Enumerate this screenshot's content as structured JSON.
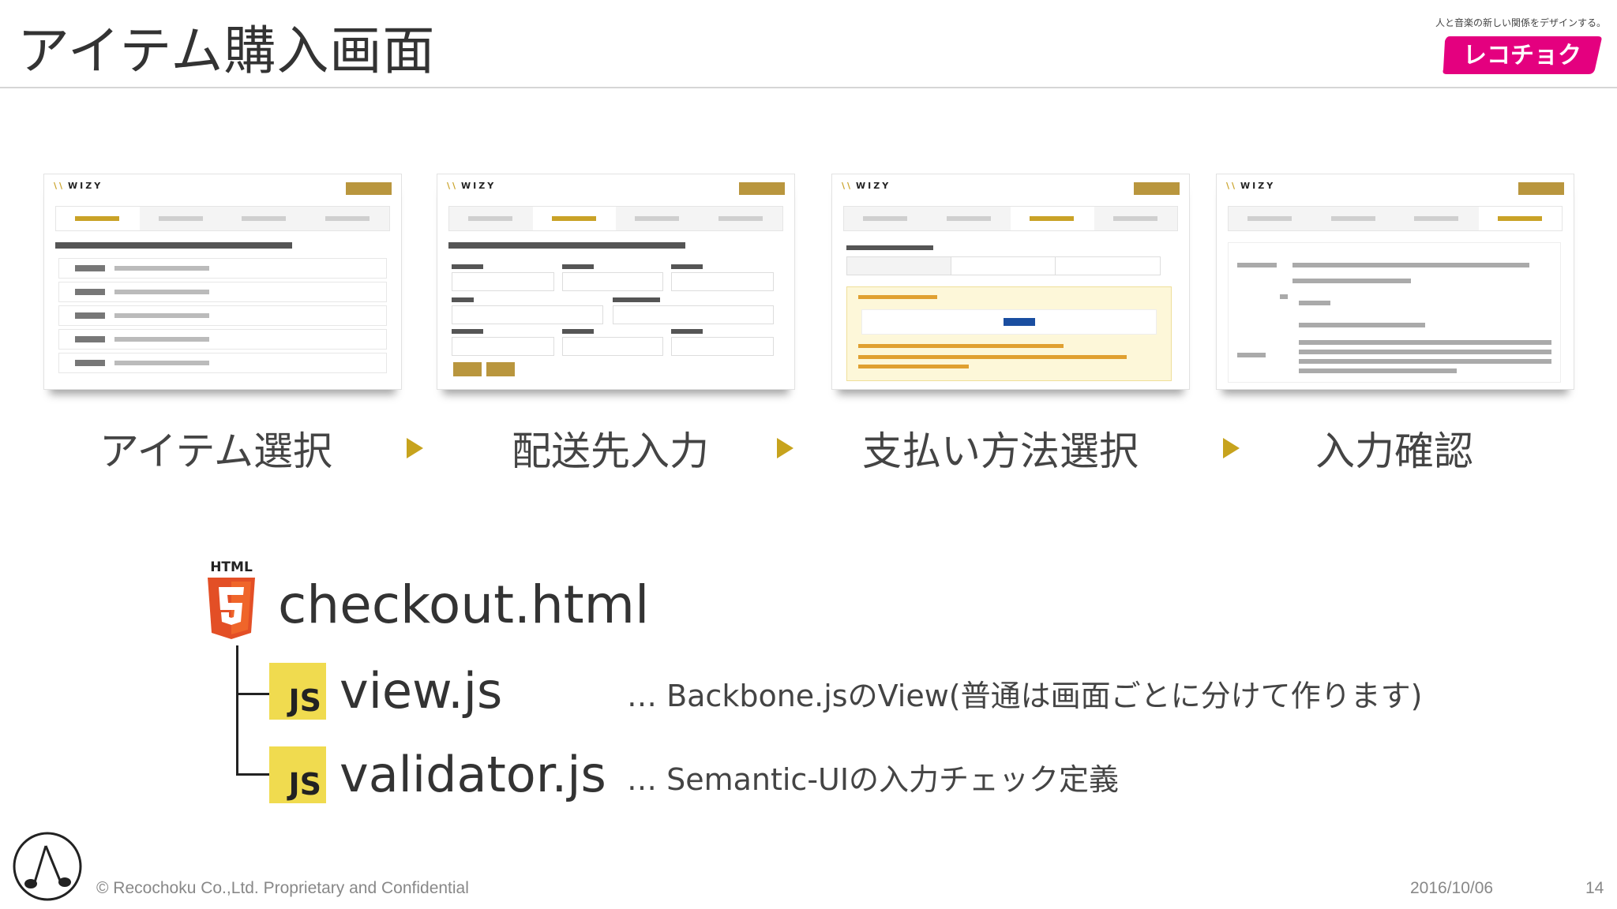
{
  "header": {
    "title": "アイテム購入画面",
    "tagline": "人と音楽の新しい関係をデザインする。",
    "logo_text": "レコチョク",
    "brand_color": "#e4007f"
  },
  "steps": [
    {
      "label": "アイテム選択"
    },
    {
      "label": "配送先入力"
    },
    {
      "label": "支払い方法選択"
    },
    {
      "label": "入力確認"
    }
  ],
  "arrow_color": "#c7a31d",
  "files": {
    "html_badge": "HTML",
    "main_file": "checkout.html",
    "js_badge": "JS",
    "children": [
      {
        "name": "view.js",
        "note": "… Backbone.jsのView(普通は画面ごとに分けて作ります)"
      },
      {
        "name": "validator.js",
        "note": "… Semantic-UIの入力チェック定義"
      }
    ]
  },
  "footer": {
    "copyright": "© Recochoku Co.,Ltd. Proprietary and Confidential",
    "date": "2016/10/06",
    "page": "14"
  }
}
